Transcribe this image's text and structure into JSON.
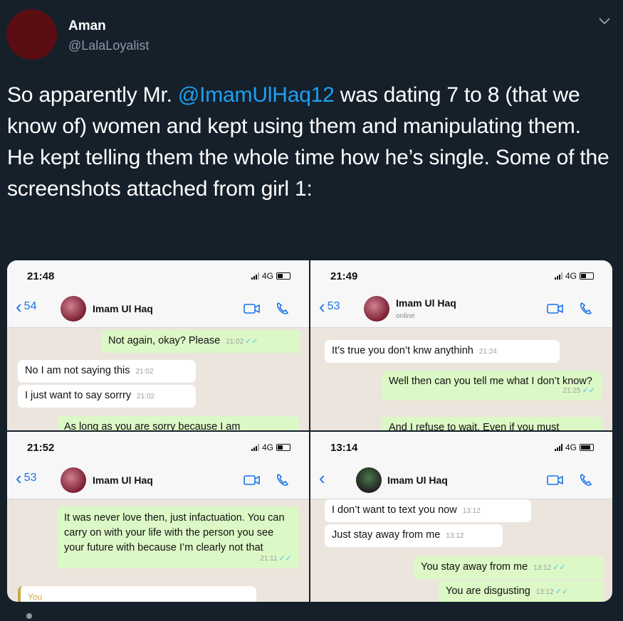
{
  "tweet": {
    "author_name": "Aman",
    "author_handle": "@LalaLoyalist",
    "text_before": "So apparently Mr. ",
    "mention": "@ImamUlHaq12",
    "text_after": " was dating 7 to 8 (that we know of) women and kept using them and manipulating them. He kept telling them the whole time how he’s single. Some of the screenshots attached from girl 1:",
    "icons": {
      "menu": "chevron-down-icon"
    }
  },
  "shots": [
    {
      "time": "21:48",
      "network": "4G",
      "back_count": "54",
      "contact": "Imam Ul Haq",
      "messages": [
        {
          "dir": "out",
          "text": "Not again, okay? Please",
          "time": "21:02"
        },
        {
          "dir": "in",
          "text": "No I am not saying this",
          "time": "21:02"
        },
        {
          "dir": "in",
          "text": "I just want to say sorrry",
          "time": "21:02"
        },
        {
          "dir": "out",
          "text": "As long as you are sorry because I am",
          "time": ""
        }
      ]
    },
    {
      "time": "21:49",
      "network": "4G",
      "back_count": "53",
      "contact": "Imam Ul Haq",
      "contact_status": "online",
      "messages": [
        {
          "dir": "in",
          "text": "It’s true you don’t knw anythinh",
          "time": "21:24"
        },
        {
          "dir": "out",
          "text": "Well then can you tell me what I don’t know?",
          "time": "21:25"
        },
        {
          "dir": "out",
          "text": "And I refuse to wait. Even if you must",
          "time": ""
        }
      ]
    },
    {
      "time": "21:52",
      "network": "4G",
      "back_count": "53",
      "contact": "Imam Ul Haq",
      "messages": [
        {
          "dir": "out",
          "text": "It was never love then, just infactuation. You can carry on with your life with the person you see your future with because I’m clearly not that",
          "time": "21:11"
        },
        {
          "dir": "quote",
          "text": "You",
          "time": ""
        }
      ]
    },
    {
      "time": "13:14",
      "network": "4G",
      "back_count": "",
      "contact": "Imam Ul Haq",
      "messages": [
        {
          "dir": "in",
          "text": "I don’t want to text you now",
          "time": "13:12"
        },
        {
          "dir": "in",
          "text": "Just stay away from me",
          "time": "13:12"
        },
        {
          "dir": "out",
          "text": "You stay away from me",
          "time": "13:12"
        },
        {
          "dir": "out",
          "text": "You are disgusting",
          "time": "13:12"
        }
      ]
    }
  ],
  "colors": {
    "background": "#15202b",
    "mention": "#1da1f2",
    "secondary_text": "#8899a6",
    "bubble_out": "#dcf8c6",
    "bubble_in": "#ffffff",
    "whatsapp_blue": "#1a73e8"
  }
}
